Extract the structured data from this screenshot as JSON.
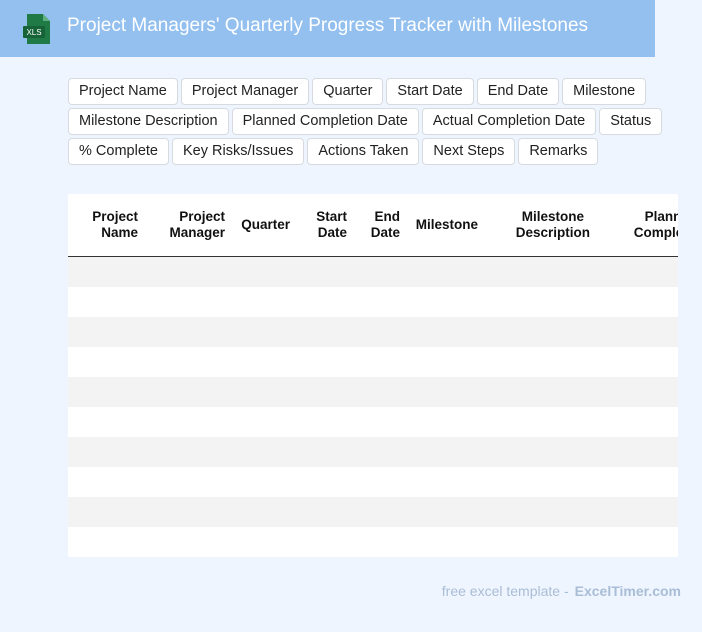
{
  "header": {
    "title": "Project Managers' Quarterly Progress Tracker with Milestones",
    "icon_label": "XLS"
  },
  "fields": [
    "Project Name",
    "Project Manager",
    "Quarter",
    "Start Date",
    "End Date",
    "Milestone",
    "Milestone Description",
    "Planned Completion Date",
    "Actual Completion Date",
    "Status",
    "% Complete",
    "Key Risks/Issues",
    "Actions Taken",
    "Next Steps",
    "Remarks"
  ],
  "table": {
    "columns": [
      {
        "line1": "Project",
        "line2": "Name"
      },
      {
        "line1": "Project",
        "line2": "Manager"
      },
      {
        "line1": "Quarter",
        "line2": ""
      },
      {
        "line1": "Start",
        "line2": "Date"
      },
      {
        "line1": "End",
        "line2": "Date"
      },
      {
        "line1": "Milestone",
        "line2": ""
      },
      {
        "line1": "Milestone",
        "line2": "Description"
      },
      {
        "line1": "Planned",
        "line2": "Completion"
      }
    ],
    "row_count": 10
  },
  "footer": {
    "text": "free excel template -",
    "brand": "ExcelTimer.com"
  },
  "colors": {
    "header_bg": "#93c0ef",
    "page_bg": "#eef5ff",
    "icon_green": "#1f7a45",
    "footer_text": "#a9bdd6"
  }
}
